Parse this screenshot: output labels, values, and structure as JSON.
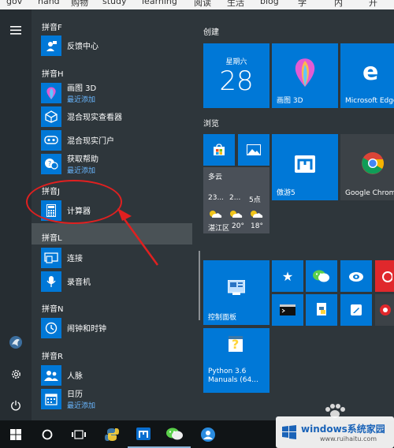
{
  "bookmarks": [
    "gov",
    "hand",
    "购物",
    "study",
    "learning",
    "阅读",
    "生活",
    "blog",
    "学",
    "内",
    "开"
  ],
  "app_list": {
    "groups": [
      {
        "header": "拼音F",
        "apps": [
          {
            "name": "反馈中心",
            "sub": "",
            "icon": "feedback-hub-icon"
          }
        ]
      },
      {
        "header": "拼音H",
        "apps": [
          {
            "name": "画图 3D",
            "sub": "最近添加",
            "icon": "paint-3d-icon"
          },
          {
            "name": "混合现实查看器",
            "sub": "",
            "icon": "mixed-reality-viewer-icon"
          },
          {
            "name": "混合现实门户",
            "sub": "",
            "icon": "mixed-reality-portal-icon"
          },
          {
            "name": "获取帮助",
            "sub": "最近添加",
            "icon": "get-help-icon"
          }
        ]
      },
      {
        "header": "拼音J",
        "apps": [
          {
            "name": "计算器",
            "sub": "",
            "icon": "calculator-icon"
          }
        ]
      },
      {
        "header": "拼音L",
        "apps": [
          {
            "name": "连接",
            "sub": "",
            "icon": "connect-icon"
          },
          {
            "name": "录音机",
            "sub": "",
            "icon": "voice-recorder-icon"
          }
        ]
      },
      {
        "header": "拼音N",
        "apps": [
          {
            "name": "闹钟和时钟",
            "sub": "",
            "icon": "alarms-clock-icon"
          }
        ]
      },
      {
        "header": "拼音R",
        "apps": [
          {
            "name": "人脉",
            "sub": "",
            "icon": "people-icon"
          },
          {
            "name": "日历",
            "sub": "最近添加",
            "icon": "calendar-icon"
          }
        ]
      }
    ]
  },
  "tiles": {
    "section_create": "创建",
    "section_browse": "浏览",
    "calendar": {
      "day": "星期六",
      "date": "28"
    },
    "paint3d": "画图 3D",
    "edge": "Microsoft Edge",
    "weather": {
      "condition": "多云",
      "days": [
        "23...",
        "2...",
        "5点"
      ],
      "location": "湛江区",
      "temps": [
        "20°",
        "20°",
        "18°"
      ]
    },
    "aoyou": "傲游5",
    "chrome": "Google Chrome",
    "control_panel": "控制面板",
    "python": "Python 3.6 Manuals (64...",
    "star_label": "★"
  },
  "annotation": {
    "accent": "#e02020"
  },
  "watermark": {
    "brand": "windows系统家园",
    "url": "www.ruihaitu.com"
  }
}
